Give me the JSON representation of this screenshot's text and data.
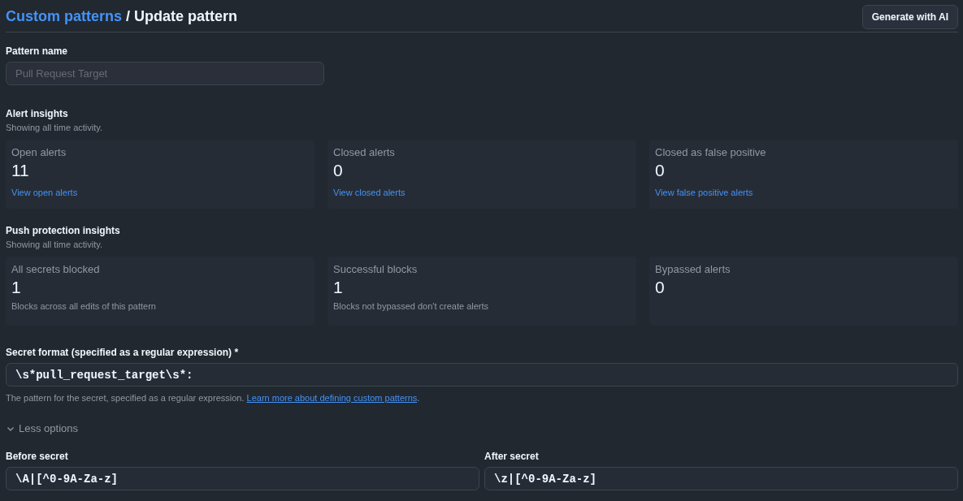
{
  "header": {
    "breadcrumb_link": "Custom patterns",
    "separator": "/",
    "title": "Update pattern",
    "button": "Generate with AI"
  },
  "pattern_name": {
    "label": "Pattern name",
    "placeholder": "Pull Request Target"
  },
  "sections": [
    {
      "title": "Alert insights",
      "subtitle": "Showing all time activity.",
      "cards": [
        {
          "label": "Open alerts",
          "value": "11",
          "footer": {
            "kind": "link",
            "text": "View open alerts"
          }
        },
        {
          "label": "Closed alerts",
          "value": "0",
          "footer": {
            "kind": "link",
            "text": "View closed alerts"
          }
        },
        {
          "label": "Closed as false positive",
          "value": "0",
          "footer": {
            "kind": "link",
            "text": "View false positive alerts"
          }
        }
      ]
    },
    {
      "title": "Push protection insights",
      "subtitle": "Showing all time activity.",
      "cards": [
        {
          "label": "All secrets blocked",
          "value": "1",
          "footer": {
            "kind": "note",
            "text": "Blocks across all edits of this pattern"
          }
        },
        {
          "label": "Successful blocks",
          "value": "1",
          "footer": {
            "kind": "note",
            "text": "Blocks not bypassed don't create alerts"
          }
        },
        {
          "label": "Bypassed alerts",
          "value": "0"
        }
      ]
    }
  ],
  "secret_format": {
    "label": "Secret format (specified as a regular expression) *",
    "value": "\\s*pull_request_target\\s*:",
    "help": "The pattern for the secret, specified as a regular expression.",
    "help_link": "Learn more about defining custom patterns",
    "help_end": "."
  },
  "options_toggle": {
    "label": "Less options",
    "expanded": true
  },
  "boundary_fields": [
    {
      "label": "Before secret",
      "value": "\\A|[^0-9A-Za-z]"
    },
    {
      "label": "After secret",
      "value": "\\z|[^0-9A-Za-z]"
    }
  ]
}
